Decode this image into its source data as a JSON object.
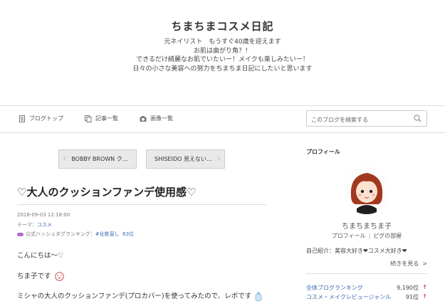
{
  "header": {
    "title": "ちまちまコスメ日記",
    "description": [
      "元ネイリスト　もうすぐ40歳を迎えます",
      "お肌は曲がり角？！",
      "できるだけ綺麗なお肌でいたいー！メイクも楽しみたいー！",
      "日々の小さな美容への努力をちまちま日記にしたいと思います"
    ]
  },
  "nav": {
    "blog_top": "ブログトップ",
    "articles": "記事一覧",
    "images": "画像一覧"
  },
  "search": {
    "placeholder": "このブログを検索する"
  },
  "pager": {
    "prev": "BOBBY BROWN ク…",
    "next": "SHISEIDO 見えない…"
  },
  "entry": {
    "title": "♡大人のクッションファンデ使用感♡",
    "datetime": "2018-09-03 12:18:00",
    "theme_label": "テーマ：",
    "theme": "コスメ",
    "hashtag_label": "公式ハッシュタグランキング：",
    "hashtag": "#化粧直し",
    "hashtag_rank": "63位",
    "lines": [
      "こんにちは〜♡",
      "ちま子です",
      "ミシャの大人のクッションファンデ(プロカバー)を使ってみたので、レポです"
    ]
  },
  "sidebar": {
    "profile_heading": "プロフィール",
    "name": "ちまちまちま子",
    "profile_link": "プロフィール",
    "room_link": "ピグの部屋",
    "intro": "自己紹介：美容大好き❤︎コスメ大好き❤︎",
    "more": "続きを見る",
    "rankings": [
      {
        "name": "全体ブログランキング",
        "value": "9,190位",
        "arrow": "↑"
      },
      {
        "name": "コスメ・メイクレビュージャンル",
        "value": "91位",
        "arrow": "↑"
      }
    ]
  },
  "colors": {
    "link": "#3c6bb5",
    "rank_up": "#e0443a",
    "hashtag_badge": "#b06bc8"
  }
}
